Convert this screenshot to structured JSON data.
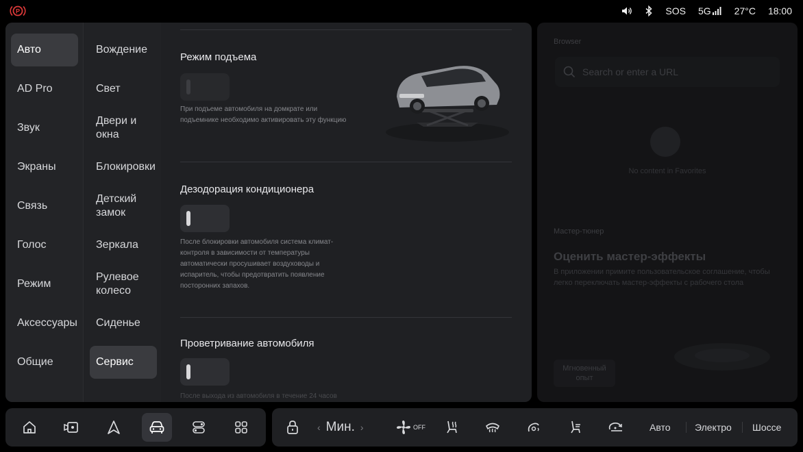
{
  "status": {
    "sos": "SOS",
    "network": "5G",
    "temperature": "27°C",
    "time": "18:00"
  },
  "settings": {
    "categories": [
      {
        "label": "Авто",
        "active": true
      },
      {
        "label": "AD Pro"
      },
      {
        "label": "Звук"
      },
      {
        "label": "Экраны"
      },
      {
        "label": "Связь"
      },
      {
        "label": "Голос"
      },
      {
        "label": "Режим"
      },
      {
        "label": "Аксессуары"
      },
      {
        "label": "Общие"
      }
    ],
    "subcategories": [
      {
        "label": "Вождение"
      },
      {
        "label": "Свет"
      },
      {
        "label": "Двери и окна"
      },
      {
        "label": "Блокировки"
      },
      {
        "label": "Детский замок"
      },
      {
        "label": "Зеркала"
      },
      {
        "label": "Рулевое колесо"
      },
      {
        "label": "Сиденье"
      },
      {
        "label": "Сервис",
        "active": true
      }
    ],
    "sections": [
      {
        "title": "Режим подъема",
        "description": "При подъеме автомобиля на домкрате или подъемнике необходимо активировать эту функцию",
        "enabled": false
      },
      {
        "title": "Дезодорация кондиционера",
        "description": "После блокировки автомобиля система климат-контроля в зависимости от температуры автоматически просушивает воздуховоды и испаритель, чтобы предотвратить появление посторонних запахов.",
        "enabled": true
      },
      {
        "title": "Проветривание автомобиля",
        "description": "После выхода из автомобиля в течение 24 часов",
        "enabled": true
      }
    ]
  },
  "right_panel": {
    "browser_label": "Browser",
    "search_placeholder": "Search or enter a URL",
    "empty_text": "No content in Favorites",
    "tuner_label": "Мастер-тюнер",
    "heading": "Оценить мастер-эффекты",
    "subtext": "В приложении примите пользовательское соглашение, чтобы легко переключать мастер-эффекты с рабочего стола",
    "instant_button": "Мгновенный опыт"
  },
  "dock": {
    "climate_temp": "Мин.",
    "fan_state": "OFF",
    "modes": [
      "Авто",
      "Электро",
      "Шоссе"
    ]
  },
  "colors": {
    "panel_bg": "#1f2023",
    "active_item": "#3a3b3f",
    "brake_icon_red": "#e03a3a"
  }
}
